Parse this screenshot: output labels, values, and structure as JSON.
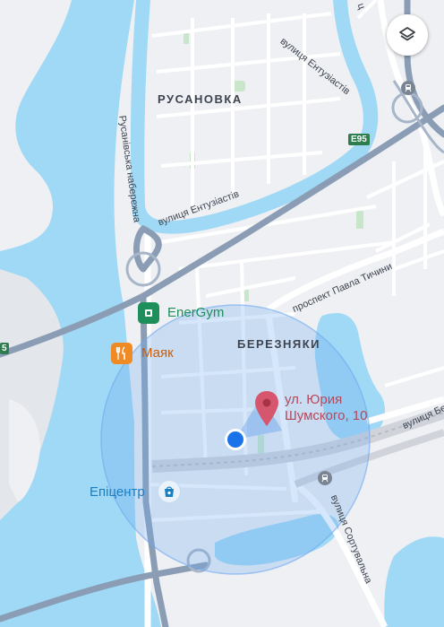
{
  "districts": {
    "rusanovka": "РУСАНОВКА",
    "bereznyaky": "БЕРЕЗНЯКИ"
  },
  "streets": {
    "entuziastiv_top": "вулиця Ентузіастів",
    "entuziastiv_bottom": "вулиця Ентузіастів",
    "rusanivska_naberezhna": "Русанівська набережна",
    "pavla_tychyny": "проспект Павла Тичини",
    "sortuvalna": "вулиця Сортувальна",
    "top_right_fragment": "ц",
    "right_edge_fragment": "вулиця Бе"
  },
  "route_shields": {
    "e95": "E95",
    "left_edge": "5"
  },
  "pois": {
    "energym": "EnerGym",
    "mayak": "Маяк",
    "epicentr": "Епіцентр"
  },
  "pin": {
    "line1": "ул. Юрия",
    "line2": "Шумского, 10"
  },
  "colors": {
    "water": "#9fd9f5",
    "land": "#eef0f3",
    "road": "#ffffff",
    "major_road": "#8b9db5",
    "park": "#c8e6c9",
    "accuracy_circle": "#6ea8f0",
    "user_dot": "#1a73e8",
    "pin": "#d6566e",
    "gym_icon": "#1e8e5a",
    "food_icon": "#f08a24",
    "epicentr_text": "#1a7fc1",
    "gym_text": "#1e8e5a",
    "food_text": "#c45f10"
  },
  "icons": {
    "layers": "layers-icon",
    "metro": "metro-icon",
    "rail": "rail-icon",
    "gym": "dumbbell-icon",
    "food": "fork-knife-icon",
    "shop": "shopping-bag-icon"
  }
}
